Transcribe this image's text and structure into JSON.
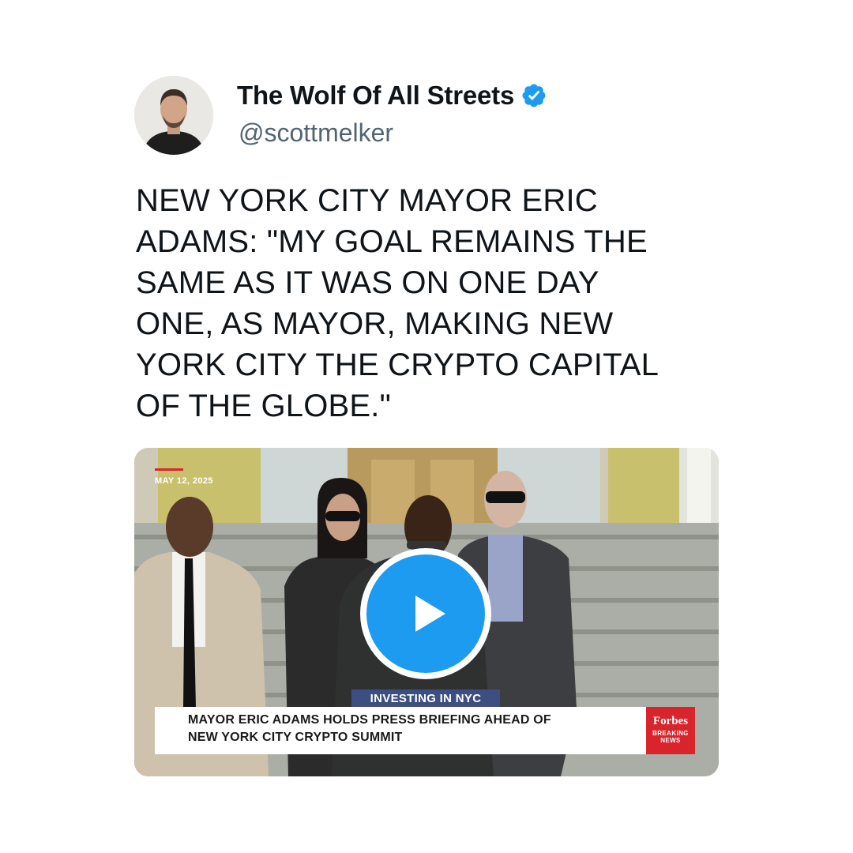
{
  "author": {
    "display_name": "The Wolf Of All Streets",
    "handle": "@scottmelker",
    "verified": true,
    "verified_icon": "verified-badge-icon",
    "verified_color": "#1d9bf0"
  },
  "tweet": {
    "text": "NEW YORK CITY MAYOR ERIC\nADAMS: \"MY GOAL REMAINS THE\nSAME AS IT WAS ON ONE DAY\nONE, AS MAYOR, MAKING NEW\nYORK CITY THE CRYPTO CAPITAL\nOF THE GLOBE.\""
  },
  "media": {
    "type": "video",
    "date": "MAY 12, 2025",
    "play_icon": "play-icon",
    "play_color": "#1d9bf0",
    "segment_tag": "INVESTING IN NYC",
    "headline": "MAYOR ERIC ADAMS HOLDS PRESS BRIEFING AHEAD OF\nNEW YORK CITY  CRYPTO SUMMIT",
    "brand": {
      "name": "Forbes",
      "subtitle": "BREAKING NEWS",
      "color": "#d8242a"
    }
  }
}
